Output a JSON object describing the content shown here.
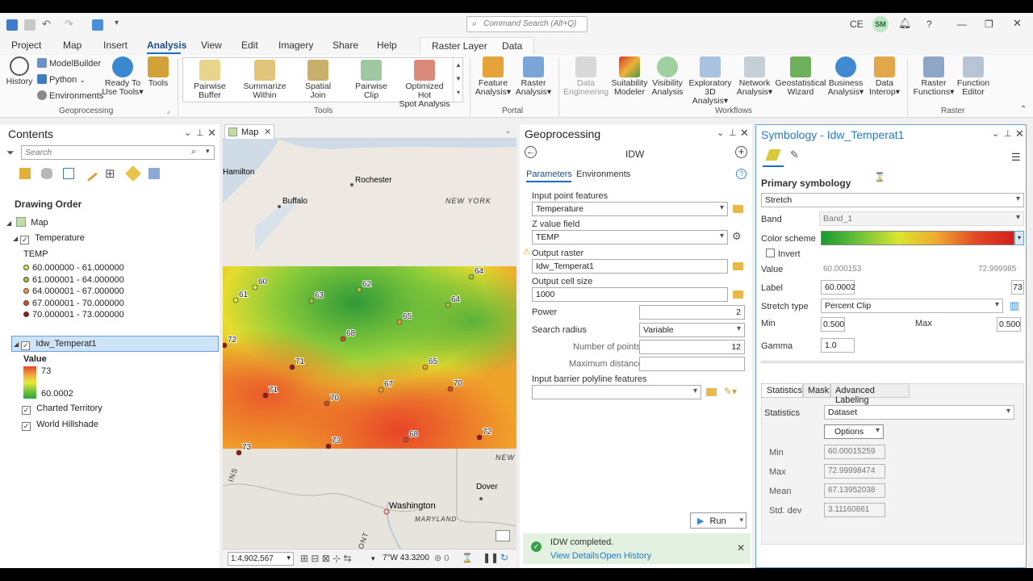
{
  "titlebar": {
    "search_placeholder": "Command Search (Alt+Q)",
    "user_initials_text": "CE",
    "avatar_text": "SM"
  },
  "tabs": [
    "Project",
    "Map",
    "Insert",
    "Analysis",
    "View",
    "Edit",
    "Imagery",
    "Share",
    "Help"
  ],
  "active_tab": "Analysis",
  "context_tabs": {
    "group": "Raster Layer",
    "tab": "Data"
  },
  "ribbon": {
    "geoprocessing": {
      "history": "History",
      "modelbuilder": "ModelBuilder",
      "python": "Python",
      "environments": "Environments",
      "ready": "Ready To",
      "ready2": "Use Tools",
      "tools": "Tools",
      "label": "Geoprocessing"
    },
    "tools_gallery": [
      [
        "Pairwise",
        "Buffer"
      ],
      [
        "Summarize",
        "Within"
      ],
      [
        "Spatial",
        "Join"
      ],
      [
        "Pairwise",
        "Clip"
      ],
      [
        "Optimized Hot",
        "Spot Analysis"
      ]
    ],
    "tools_label": "Tools",
    "portal": {
      "feature1": "Feature",
      "feature2": "Analysis",
      "raster1": "Raster",
      "raster2": "Analysis",
      "label": "Portal"
    },
    "workflows": {
      "data1": "Data",
      "data2": "Engineering",
      "suit1": "Suitability",
      "suit2": "Modeler",
      "vis1": "Visibility",
      "vis2": "Analysis",
      "exp1": "Exploratory",
      "exp2": "3D Analysis",
      "net1": "Network",
      "net2": "Analysis",
      "geo1": "Geostatistical",
      "geo2": "Wizard",
      "bus1": "Business",
      "bus2": "Analysis",
      "di1": "Data",
      "di2": "Interop",
      "label": "Workflows"
    },
    "raster": {
      "rf1": "Raster",
      "rf2": "Functions",
      "fe1": "Function",
      "fe2": "Editor",
      "label": "Raster"
    }
  },
  "contents": {
    "title": "Contents",
    "search_placeholder": "Search",
    "drawing_order": "Drawing Order",
    "map": "Map",
    "temperature_layer": "Temperature",
    "temp_field": "TEMP",
    "classes": [
      {
        "label": "60.000000 - 61.000000",
        "color": "#d9e84a"
      },
      {
        "label": "61.000001 - 64.000000",
        "color": "#a6c43c"
      },
      {
        "label": "64.000001 - 67.000000",
        "color": "#e8a13a"
      },
      {
        "label": "67.000001 - 70.000000",
        "color": "#c9502a"
      },
      {
        "label": "70.000001 - 73.000000",
        "color": "#9e1515"
      }
    ],
    "idw_layer": "Idw_Temperat1",
    "value_heading": "Value",
    "value_max": "73",
    "value_min": "60.0002",
    "charted": "Charted Territory",
    "hillshade": "World Hillshade"
  },
  "map": {
    "tab": "Map",
    "places": {
      "hamilton": "Hamilton",
      "rochester": "Rochester",
      "buffalo": "Buffalo",
      "new_york": "NEW YORK",
      "new2": "NEW",
      "dover": "Dover",
      "washington": "Washington",
      "maryland": "MARYLAND",
      "frag1": "INS",
      "frag2": "ONT"
    },
    "points": [
      "60",
      "61",
      "63",
      "62",
      "64",
      "64",
      "65",
      "68",
      "65",
      "72",
      "71",
      "71",
      "70",
      "67",
      "70",
      "73",
      "68",
      "72",
      "73"
    ],
    "scale": "1:4,902,567",
    "coords": "7°W 43.3200"
  },
  "geoprocessing": {
    "title": "Geoprocessing",
    "tool": "IDW",
    "tab_params": "Parameters",
    "tab_env": "Environments",
    "input_label": "Input point features",
    "input_value": "Temperature",
    "z_label": "Z value field",
    "z_value": "TEMP",
    "out_label": "Output raster",
    "out_value": "Idw_Temperat1",
    "cell_label": "Output cell size",
    "cell_value": "1000",
    "power_label": "Power",
    "power_value": "2",
    "radius_label": "Search radius",
    "radius_value": "Variable",
    "npoints_label": "Number of points",
    "npoints_value": "12",
    "maxdist_label": "Maximum distance",
    "barrier_label": "Input barrier polyline features",
    "run": "Run",
    "completed": "IDW completed.",
    "view_details": "View Details",
    "open_history": "Open History"
  },
  "symbology": {
    "title": "Symbology - Idw_Temperat1",
    "primary": "Primary symbology",
    "renderer": "Stretch",
    "band_label": "Band",
    "band_value": "Band_1",
    "scheme_label": "Color scheme",
    "invert": "Invert",
    "value_label": "Value",
    "value_min": "60.000153",
    "value_max": "72.999985",
    "label_label": "Label",
    "label_min": "60.0002",
    "label_max": "73",
    "stretch_label": "Stretch type",
    "stretch_value": "Percent Clip",
    "min_label": "Min",
    "min_value": "0.500",
    "max_label": "Max",
    "max_value": "0.500",
    "gamma_label": "Gamma",
    "gamma_value": "1.0",
    "tab_stats": "Statistics",
    "tab_mask": "Mask",
    "tab_adv": "Advanced Labeling",
    "stats_label": "Statistics",
    "stats_value": "Dataset",
    "options": "Options",
    "s_min_label": "Min",
    "s_min": "60.00015259",
    "s_max_label": "Max",
    "s_max": "72.99998474",
    "s_mean_label": "Mean",
    "s_mean": "67.13952038",
    "s_std_label": "Std. dev",
    "s_std": "3.11160861"
  }
}
